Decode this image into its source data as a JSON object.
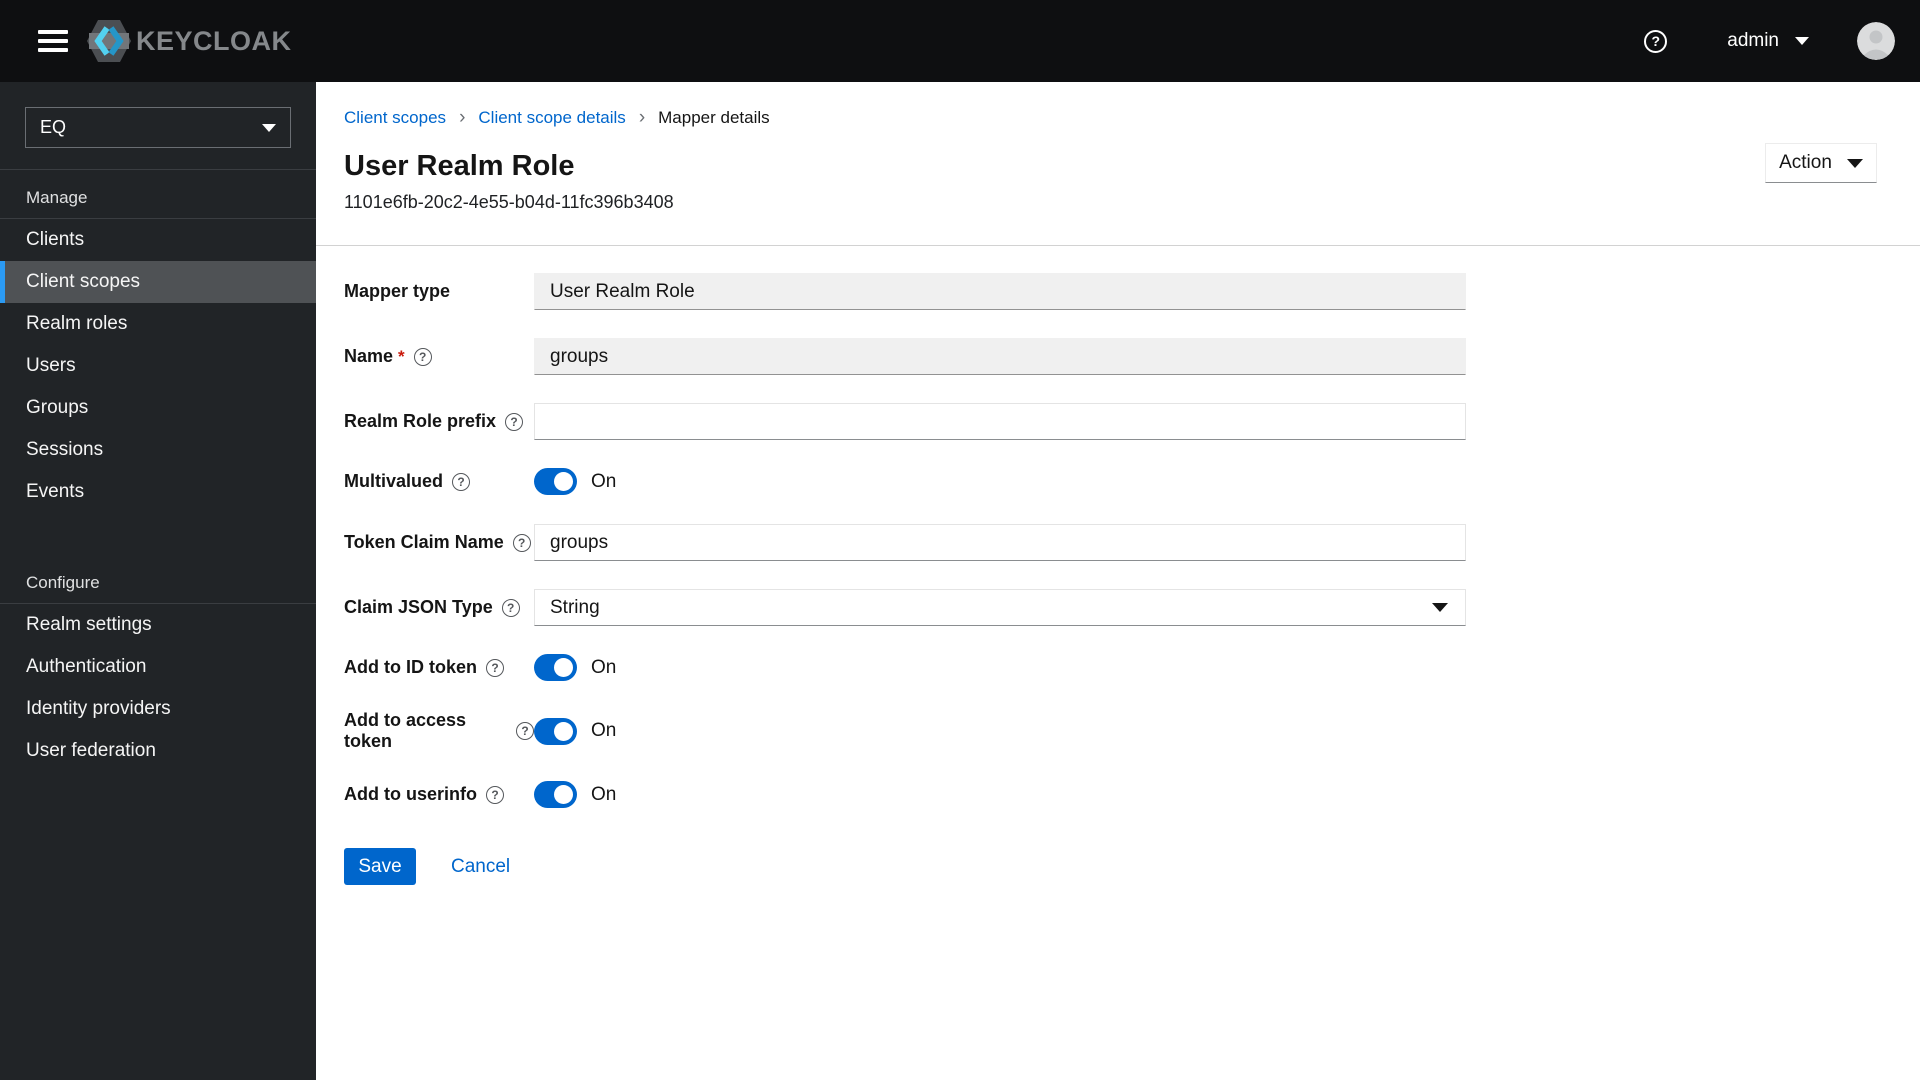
{
  "masthead": {
    "brand": "KEYCLOAK",
    "user": "admin",
    "help_glyph": "?"
  },
  "sidebar": {
    "realm": "EQ",
    "selected_item": "Client scopes",
    "sections": [
      {
        "label": "Manage",
        "items": [
          "Clients",
          "Client scopes",
          "Realm roles",
          "Users",
          "Groups",
          "Sessions",
          "Events"
        ]
      },
      {
        "label": "Configure",
        "items": [
          "Realm settings",
          "Authentication",
          "Identity providers",
          "User federation"
        ]
      }
    ]
  },
  "breadcrumb": {
    "items": [
      "Client scopes",
      "Client scope details",
      "Mapper details"
    ]
  },
  "header": {
    "title": "User Realm Role",
    "subtitle": "1101e6fb-20c2-4e55-b04d-11fc396b3408",
    "action_label": "Action"
  },
  "form": {
    "mapper_type": {
      "label": "Mapper type",
      "value": "User Realm Role"
    },
    "name": {
      "label": "Name",
      "required_mark": "*",
      "value": "groups"
    },
    "realm_role_prefix": {
      "label": "Realm Role prefix",
      "value": ""
    },
    "multivalued": {
      "label": "Multivalued",
      "state": "On"
    },
    "token_claim_name": {
      "label": "Token Claim Name",
      "value": "groups"
    },
    "claim_json_type": {
      "label": "Claim JSON Type",
      "value": "String"
    },
    "add_to_id_token": {
      "label": "Add to ID token",
      "state": "On"
    },
    "add_to_access_token": {
      "label": "Add to access token",
      "state": "On"
    },
    "add_to_userinfo": {
      "label": "Add to userinfo",
      "state": "On"
    },
    "help_glyph": "?",
    "save_label": "Save",
    "cancel_label": "Cancel"
  },
  "colors": {
    "primary_blue": "#0066cc",
    "nav_current_indicator": "#2b9af3",
    "masthead_bg": "#0e0f11",
    "sidebar_bg": "#212427",
    "required_red": "#c9190b"
  }
}
